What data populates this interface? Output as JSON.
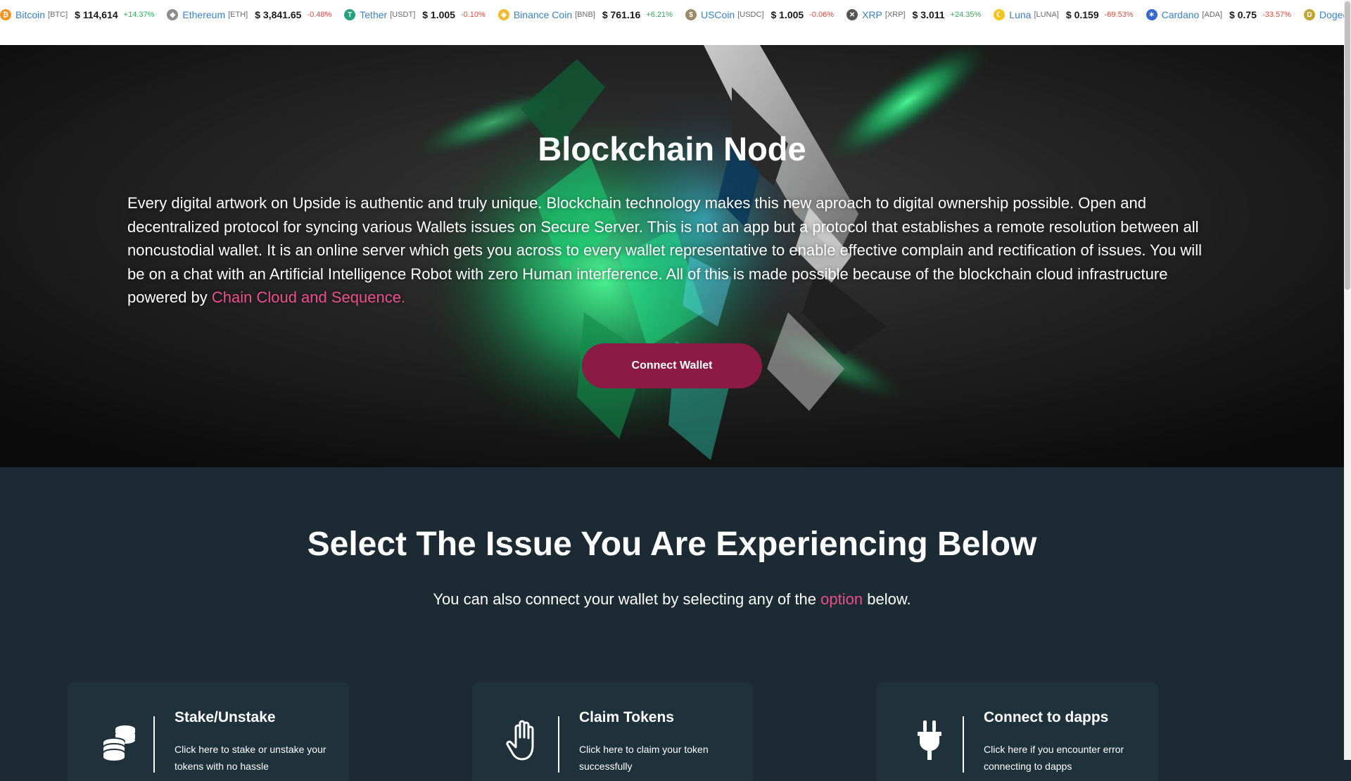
{
  "ticker": {
    "items": [
      {
        "name": "Bitcoin",
        "symbol": "[BTC]",
        "price": "$ 114,614",
        "change": "+14.37%",
        "direction": "up",
        "icon": "bitcoin-icon",
        "color": "#f7931a"
      },
      {
        "name": "Ethereum",
        "symbol": "[ETH]",
        "price": "$ 3,841.65",
        "change": "-0.48%",
        "direction": "down",
        "icon": "ethereum-icon",
        "color": "#8c8c8c"
      },
      {
        "name": "Tether",
        "symbol": "[USDT]",
        "price": "$ 1.005",
        "change": "-0.10%",
        "direction": "down",
        "icon": "tether-icon",
        "color": "#26a17b"
      },
      {
        "name": "Binance Coin",
        "symbol": "[BNB]",
        "price": "$ 761.16",
        "change": "+6.21%",
        "direction": "up",
        "icon": "binance-icon",
        "color": "#f3ba2f"
      },
      {
        "name": "USCoin",
        "symbol": "[USDC]",
        "price": "$ 1.005",
        "change": "-0.06%",
        "direction": "down",
        "icon": "uscoin-icon",
        "color": "#9a8a6a"
      },
      {
        "name": "XRP",
        "symbol": "[XRP]",
        "price": "$ 3.011",
        "change": "+24.35%",
        "direction": "up",
        "icon": "xrp-icon",
        "color": "#555555"
      },
      {
        "name": "Luna",
        "symbol": "[LUNA]",
        "price": "$ 0.159",
        "change": "-69.53%",
        "direction": "down",
        "icon": "luna-icon",
        "color": "#f5c518"
      },
      {
        "name": "Cardano",
        "symbol": "[ADA]",
        "price": "$ 0.75",
        "change": "-33.57%",
        "direction": "down",
        "icon": "cardano-icon",
        "color": "#3468d1"
      },
      {
        "name": "Dogecoin",
        "symbol": "",
        "price": "",
        "change": "",
        "direction": "up",
        "icon": "dogecoin-icon",
        "color": "#c2a633"
      }
    ]
  },
  "hero": {
    "title": "Blockchain Node",
    "text": "Every digital artwork on Upside is authentic and truly unique. Blockchain technology makes this new aproach to digital ownership possible. Open and decentralized protocol for syncing various Wallets issues on Secure Server. This is not an app but a protocol that establishes a remote resolution between all noncustodial wallet. It is an online server which gets you across to every wallet representative to enable effective complain and rectification of issues. You will be on a chat with an Artificial Intelligence Robot with zero Human interference. All of this is made possible because of the blockchain cloud infrastructure powered by ",
    "highlight": "Chain Cloud and Sequence.",
    "button_label": "Connect Wallet"
  },
  "issues": {
    "title": "Select The Issue You Are Experiencing Below",
    "subtitle_before": "You can also connect your wallet by selecting any of the ",
    "subtitle_highlight": "option",
    "subtitle_after": " below.",
    "cards": [
      {
        "title": "Stake/Unstake",
        "desc": "Click here to stake or unstake your tokens with no hassle",
        "icon": "coins-icon"
      },
      {
        "title": "Claim Tokens",
        "desc": "Click here to claim your token successfully",
        "icon": "hand-icon"
      },
      {
        "title": "Connect to dapps",
        "desc": "Click here if you encounter error connecting to dapps",
        "icon": "plug-icon"
      }
    ]
  },
  "colors": {
    "accent_pink": "#ec4f8b",
    "button": "#8b1a44",
    "section_bg": "#1b2a33",
    "card_bg": "#1f323c"
  }
}
